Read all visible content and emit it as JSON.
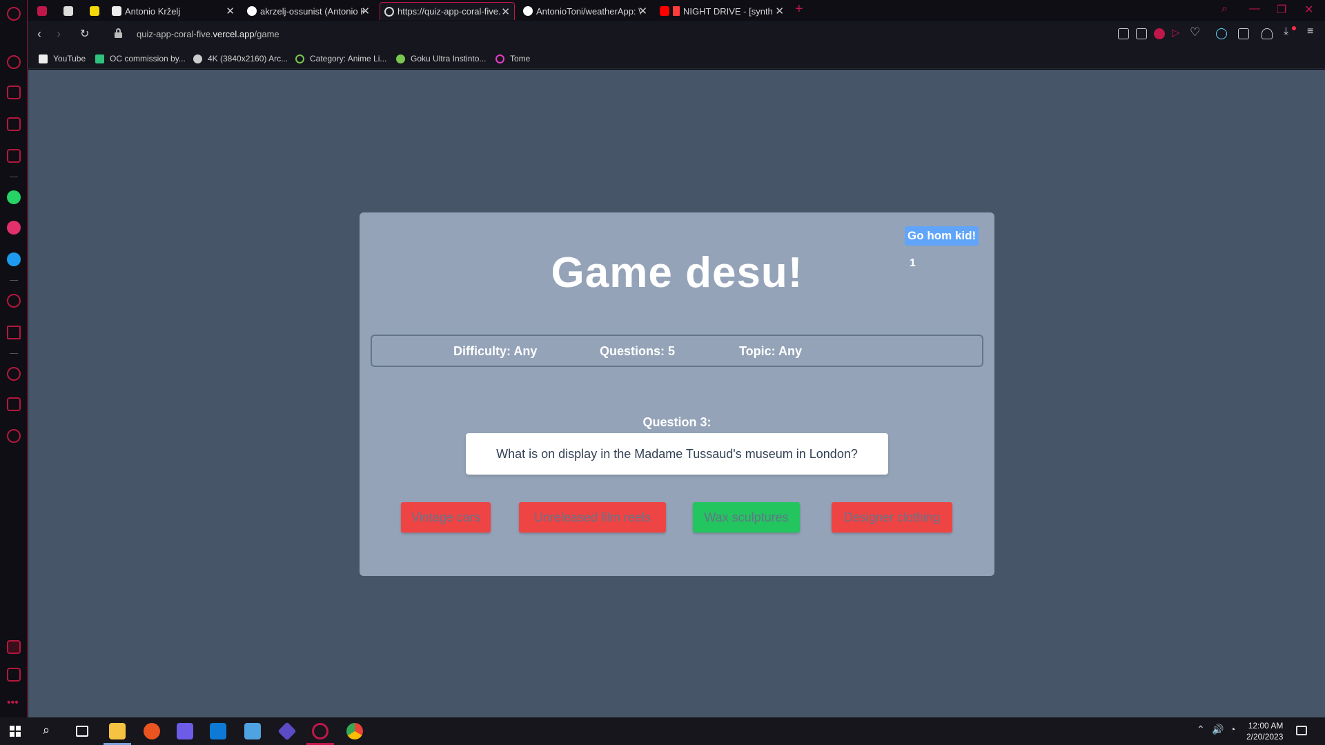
{
  "browser": {
    "tabs": [
      {
        "title": "",
        "active": false
      },
      {
        "title": "",
        "active": false
      },
      {
        "title": "Antonio Krželj",
        "active": false
      },
      {
        "title": "akrzelj-ossunist (Antonio K",
        "active": false
      },
      {
        "title": "https://quiz-app-coral-five.",
        "active": true
      },
      {
        "title": "AntonioToni/weatherApp: \\",
        "active": false
      },
      {
        "title": "NIGHT DRIVE - [synthw",
        "active": false
      }
    ],
    "url_prefix": "quiz-app-coral-five.",
    "url_domain": "vercel.app",
    "url_path": "/game",
    "bookmarks": [
      "YouTube",
      "OC commission by...",
      "4K (3840x2160) Arc...",
      "Category: Anime Li...",
      "Goku Ultra Instinto...",
      "Tome"
    ],
    "accent": "#c0174a"
  },
  "page": {
    "home_button": "Go hom kid!",
    "counter": "1",
    "title": "Game desu!",
    "info": {
      "difficulty": "Difficulty: Any",
      "questions": "Questions: 5",
      "topic": "Topic: Any"
    },
    "question_label": "Question 3:",
    "question_text": "What is on display in the Madame Tussaud's museum in London?",
    "answers": [
      {
        "label": "Vintage cars",
        "status": "wrong"
      },
      {
        "label": "Unreleased film reels",
        "status": "wrong"
      },
      {
        "label": "Wax sculptures",
        "status": "correct"
      },
      {
        "label": "Designer clothing",
        "status": "wrong"
      }
    ],
    "colors": {
      "background": "#475569",
      "card": "#94a3b8",
      "home_button": "#60a5fa",
      "wrong": "#ef4444",
      "correct": "#22c55e"
    }
  },
  "taskbar": {
    "time": "12:00 AM",
    "date": "2/20/2023"
  }
}
